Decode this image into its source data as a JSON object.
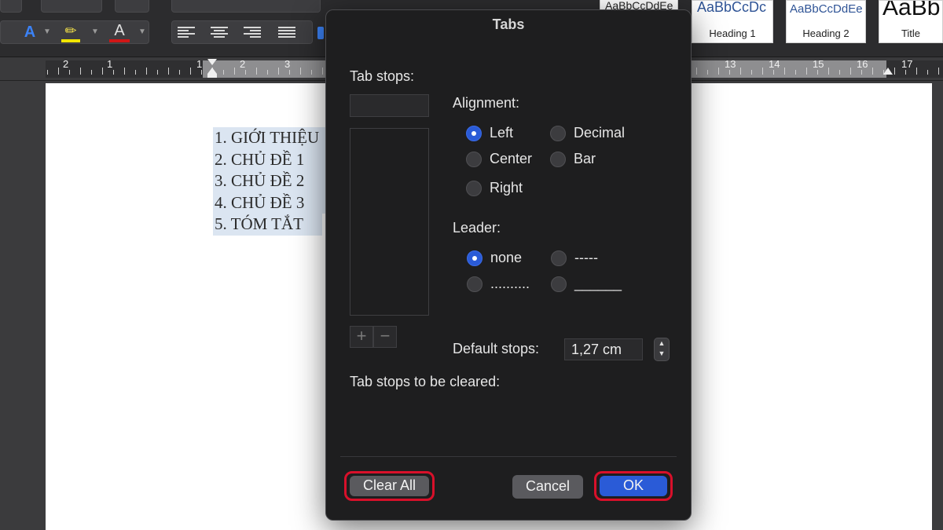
{
  "ribbon": {
    "font_color_letter": "A",
    "highlight_letter": "✏",
    "text_color_letter": "A",
    "style_gallery": [
      {
        "sample": "AaBbCcDdEe",
        "name": ""
      },
      {
        "sample": "AaBbCcDdEe",
        "name": ""
      },
      {
        "sample": "AaBbCcDc",
        "name": "Heading 1"
      },
      {
        "sample": "AaBbCcDdEe",
        "name": "Heading 2"
      },
      {
        "sample": "AaBb",
        "name": "Title"
      }
    ]
  },
  "ruler": {
    "numbers": [
      "2",
      "1",
      "1",
      "2",
      "3",
      "13",
      "14",
      "15",
      "16",
      "17"
    ]
  },
  "document": {
    "lines": [
      "1. GIỚI THIỆU",
      "2. CHỦ ĐỀ 1",
      "3. CHỦ ĐỀ 2",
      "4. CHỦ ĐỀ 3",
      "5. TÓM TẮT"
    ]
  },
  "dialog": {
    "title": "Tabs",
    "tab_stops_label": "Tab stops:",
    "tab_stop_value": "",
    "plus": "+",
    "minus": "−",
    "alignment_label": "Alignment:",
    "alignment_options": {
      "left": "Left",
      "decimal": "Decimal",
      "center": "Center",
      "bar": "Bar",
      "right": "Right"
    },
    "alignment_selected": "Left",
    "leader_label": "Leader:",
    "leader_options": {
      "none": "none",
      "dashes": "-----",
      "dots": "..........",
      "underline": "______"
    },
    "leader_selected": "none",
    "default_stops_label": "Default stops:",
    "default_stops_value": "1,27 cm",
    "cleared_label": "Tab stops to be cleared:",
    "clear_all": "Clear All",
    "cancel": "Cancel",
    "ok": "OK"
  },
  "colors": {
    "accent": "#2a5bd7",
    "highlight_ring": "#d8102a",
    "selection": "#dbe5f1"
  }
}
